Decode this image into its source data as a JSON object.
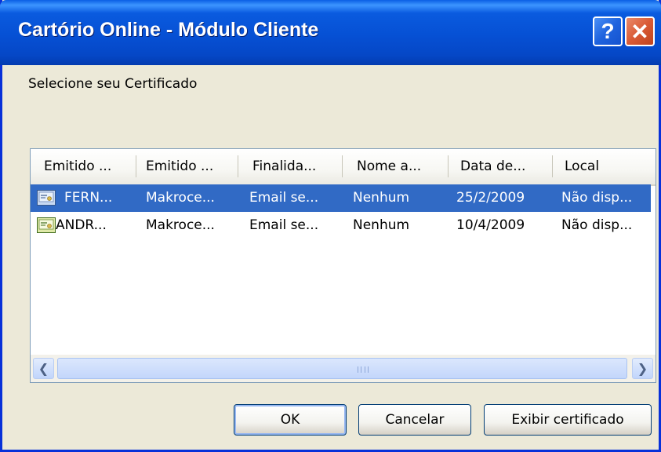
{
  "window": {
    "title": "Cartório Online - Módulo Cliente",
    "help_label": "?",
    "close_label": "✕"
  },
  "prompt": "Selecione seu Certificado",
  "columns": [
    "Emitido ...",
    "Emitido ...",
    "Finalida...",
    "Nome a...",
    "Data de...",
    "Local"
  ],
  "rows": [
    {
      "issued_to": "FERN...",
      "issued_by": "Makroce...",
      "purpose": "Email se...",
      "name": "Nenhum",
      "date": "25/2/2009",
      "local": "Não disp...",
      "selected": true
    },
    {
      "issued_to": "ANDR...",
      "issued_by": "Makroce...",
      "purpose": "Email se...",
      "name": "Nenhum",
      "date": "10/4/2009",
      "local": "Não disp...",
      "selected": false
    }
  ],
  "scrollbar": {
    "left_arrow": "❮",
    "right_arrow": "❯"
  },
  "buttons": {
    "ok": "OK",
    "cancel": "Cancelar",
    "view": "Exibir certificado"
  },
  "icons": {
    "help": "help-icon",
    "close": "close-icon",
    "certificate": "certificate-icon"
  },
  "colors": {
    "selection": "#316ac5",
    "titlebar": "#0a5bdf",
    "dialog_bg": "#ece9d8",
    "close_button": "#d95a35"
  }
}
